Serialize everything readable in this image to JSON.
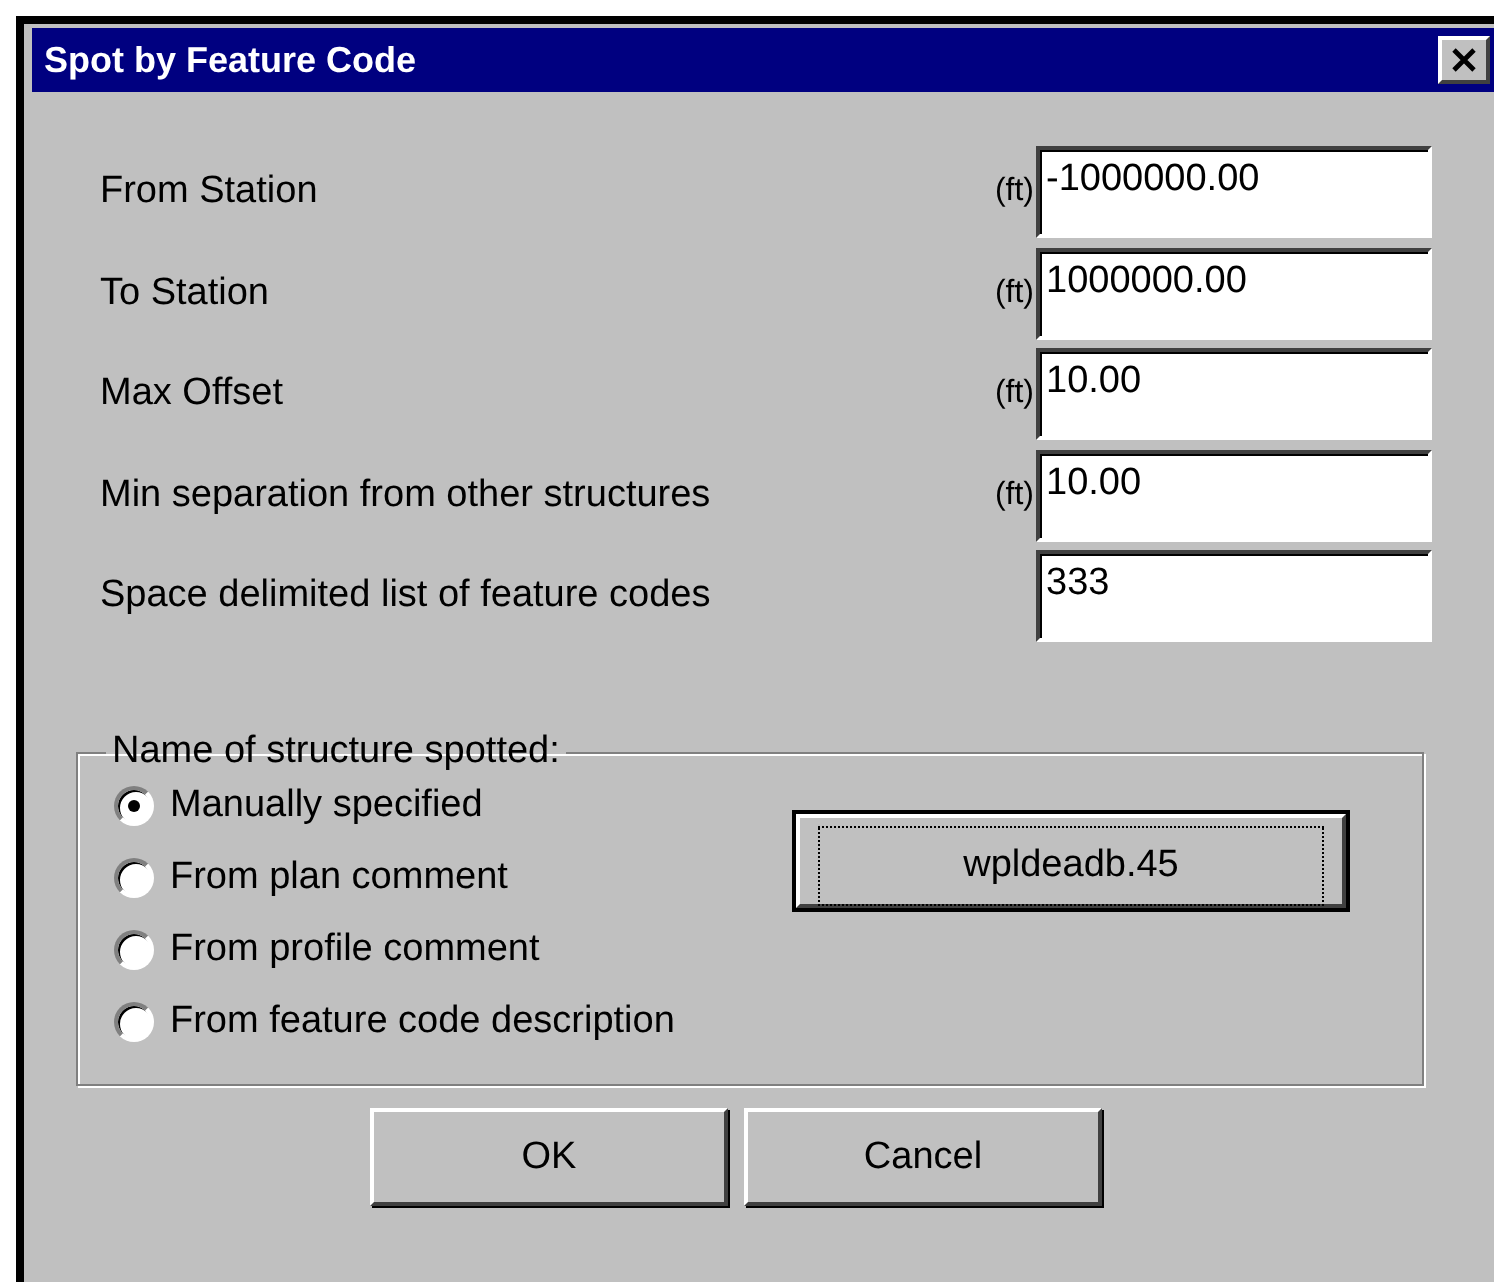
{
  "window": {
    "title": "Spot by Feature Code"
  },
  "fields": [
    {
      "label": "From Station",
      "unit": "(ft)",
      "value": "-1000000.00"
    },
    {
      "label": "To Station",
      "unit": "(ft)",
      "value": "1000000.00"
    },
    {
      "label": "Max Offset",
      "unit": "(ft)",
      "value": "10.00"
    },
    {
      "label": "Min separation from other structures",
      "unit": "(ft)",
      "value": "10.00"
    },
    {
      "label": "Space delimited list of feature codes",
      "value": "333"
    }
  ],
  "group": {
    "legend": "Name of structure spotted:",
    "options": [
      {
        "label": "Manually specified",
        "selected": true
      },
      {
        "label": "From plan comment",
        "selected": false
      },
      {
        "label": "From profile comment",
        "selected": false
      },
      {
        "label": "From feature code description",
        "selected": false
      }
    ],
    "name_button": "wpldeadb.45"
  },
  "buttons": [
    "OK",
    "Cancel"
  ]
}
